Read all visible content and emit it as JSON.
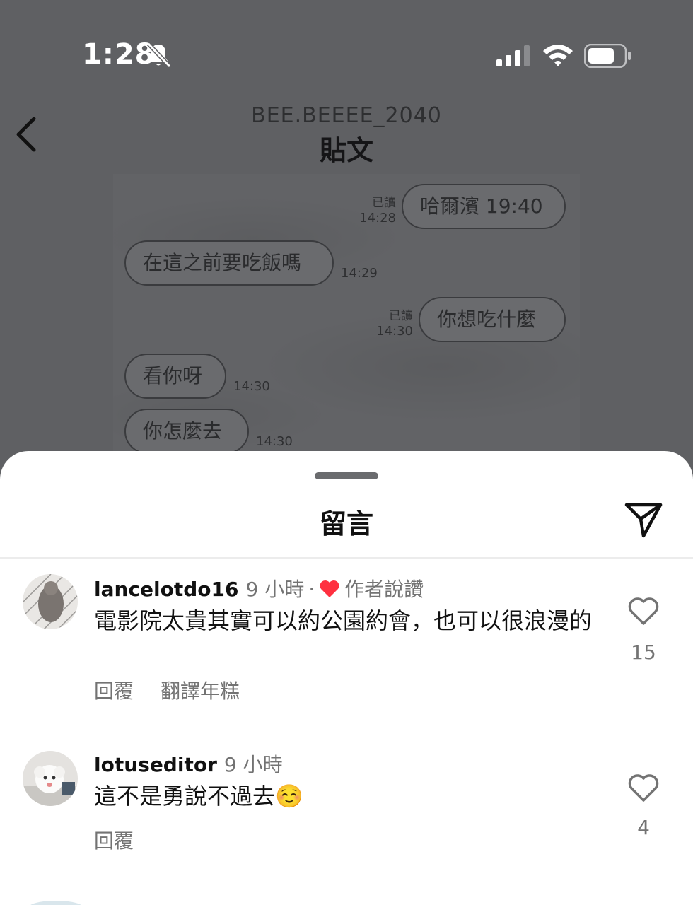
{
  "status_bar": {
    "time": "1:28"
  },
  "post_header": {
    "username": "BEE.BEEEE_2040",
    "title": "貼文"
  },
  "chat": {
    "messages": [
      {
        "side": "right",
        "text": "哈爾濱 19:40",
        "read": "已讀",
        "time": "14:28"
      },
      {
        "side": "left",
        "text": "在這之前要吃飯嗎",
        "time": "14:29"
      },
      {
        "side": "right",
        "text": "你想吃什麼",
        "read": "已讀",
        "time": "14:30"
      },
      {
        "side": "left",
        "text": "看你呀",
        "time": "14:30"
      },
      {
        "side": "left",
        "text": "你怎麼去",
        "time": "14:30"
      }
    ]
  },
  "comments_sheet": {
    "title": "留言",
    "comments": [
      {
        "username": "lancelotdo16",
        "time": "9 小時",
        "separator": "·",
        "liked_by_author": "作者說讚",
        "text": "電影院太貴其實可以約公園約會，也可以很浪漫的",
        "reply": "回覆",
        "translate": "翻譯年糕",
        "likes": "15"
      },
      {
        "username": "lotuseditor",
        "time": "9 小時",
        "text": "這不是勇說不過去☺️",
        "reply": "回覆",
        "likes": "4"
      }
    ]
  },
  "colors": {
    "liked_heart": "#ff3040",
    "muted_text": "#737373",
    "dim_overlay": "#5f6063"
  },
  "icons": [
    "back-icon",
    "bell-slash-icon",
    "signal-icon",
    "wifi-icon",
    "battery-icon",
    "send-icon",
    "heart-icon"
  ]
}
